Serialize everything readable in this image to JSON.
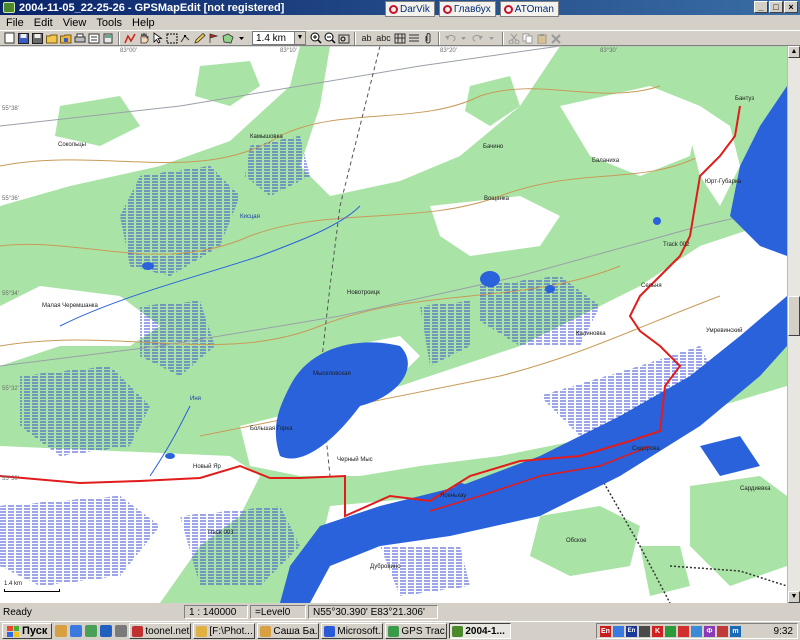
{
  "window": {
    "title": "2004-11-05_22-25-26 - GPSMapEdit [not registered]",
    "controls": [
      "_",
      "□",
      "×"
    ]
  },
  "ext_tabs": [
    "DarVik",
    "Главбух",
    "ATOman"
  ],
  "menu": [
    "File",
    "Edit",
    "View",
    "Tools",
    "Help"
  ],
  "toolbar": {
    "scale_value": "1.4 km",
    "text_tool_1": "ab",
    "text_tool_2": "abc"
  },
  "map": {
    "places": [
      "Бантуз",
      "Камышовка",
      "Бачино",
      "Баланиха",
      "Вощанка",
      "Юрт-Губарка",
      "Новотроицк",
      "Малая Черемшанка",
      "Калиновка",
      "Умревинский",
      "Сельня",
      "Большая Горка",
      "Новый Яр",
      "Черный Мыс",
      "Ясеньхау",
      "Мысеповская",
      "Сидорова",
      "Обское",
      "Дубровино",
      "Сардиевка",
      "Сокольцы"
    ],
    "rivers": [
      "Кисцая",
      "Иня"
    ],
    "tracks": [
      "Track 002",
      "Track 003"
    ],
    "scale_bar": "1.4 km",
    "coords": [
      "55°38'",
      "55°36'",
      "55°34'",
      "55°32'",
      "55°30'",
      "83°00'",
      "83°10'",
      "83°20'",
      "83°30'"
    ]
  },
  "colors": {
    "forest": "#a9e4a6",
    "water": "#2a62dc",
    "track": "#e21b1b",
    "contour": "#c89a58",
    "road": "#9aa0a8"
  },
  "status": {
    "ready": "Ready",
    "scale": "1 : 140000",
    "level": "=Level0",
    "coords": "N55°30.390' E83°21.306'"
  },
  "taskbar": {
    "start": "Пуск",
    "buttons": [
      "toonel.net",
      "[F:\\Phot...",
      "Саша Ба...",
      "Microsoft...",
      "GPS Trac...",
      "2004-1..."
    ],
    "lang": "En",
    "tray_icons": [
      "En",
      "K",
      "Ф",
      "m"
    ],
    "clock": "9:32"
  }
}
